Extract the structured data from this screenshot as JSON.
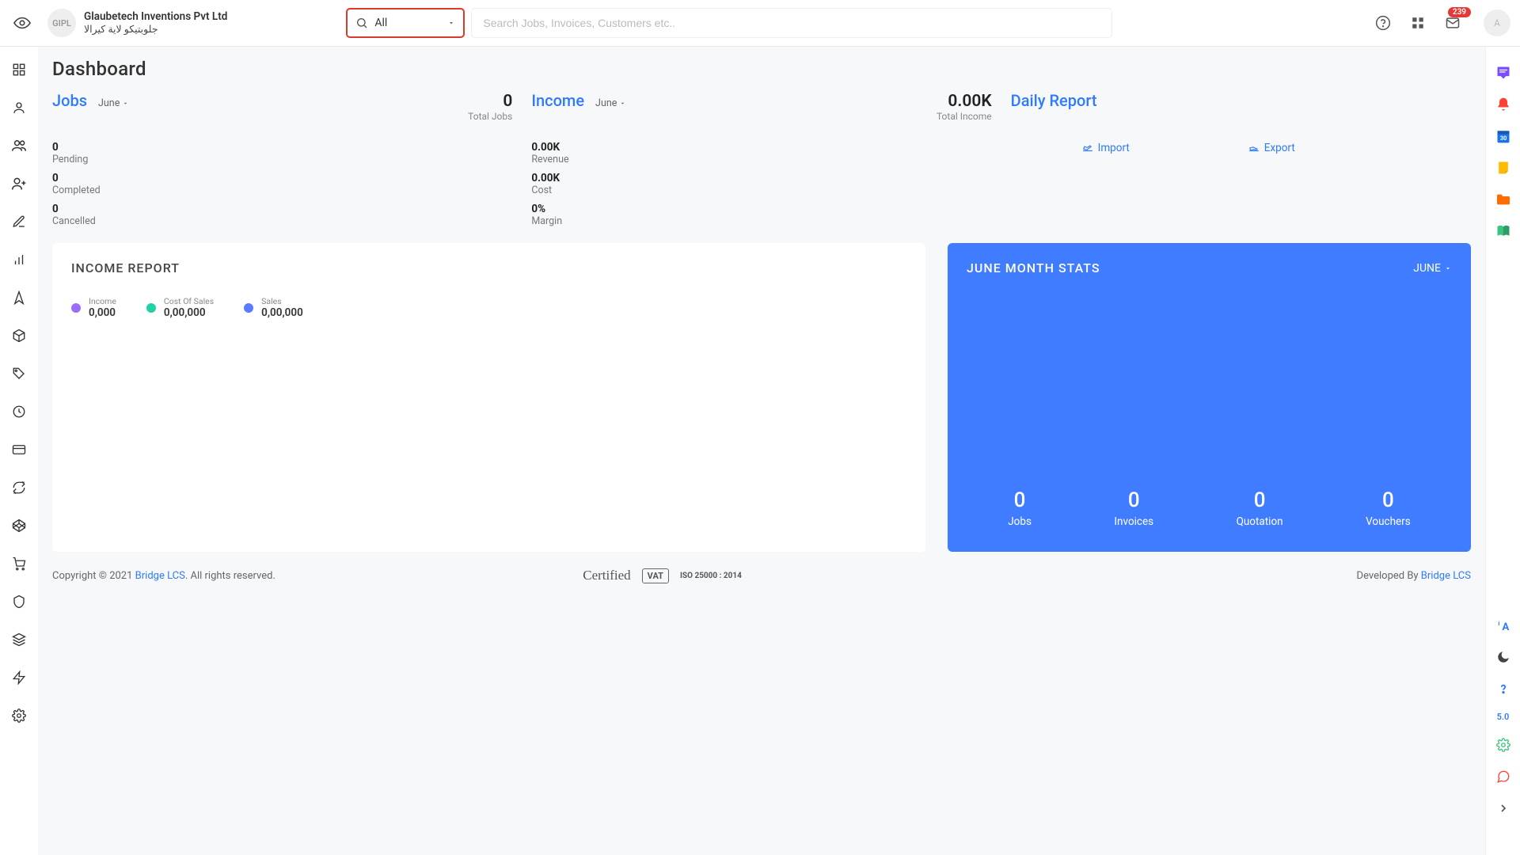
{
  "header": {
    "company_initials": "GIPL",
    "company_name": "Glaubetech Inventions Pvt Ltd",
    "company_sub": "جلوبتيكو لاية كيرالا",
    "search_scope": "All",
    "search_placeholder": "Search Jobs, Invoices, Customers etc..",
    "mail_badge": "239",
    "user_initial": "A"
  },
  "page_title": "Dashboard",
  "jobs": {
    "title": "Jobs",
    "month": "June",
    "total_val": "0",
    "total_lbl": "Total Jobs",
    "items": [
      {
        "v": "0",
        "l": "Pending"
      },
      {
        "v": "0",
        "l": "Completed"
      },
      {
        "v": "0",
        "l": "Cancelled"
      }
    ]
  },
  "income": {
    "title": "Income",
    "month": "June",
    "total_val": "0.00K",
    "total_lbl": "Total Income",
    "items": [
      {
        "v": "0.00K",
        "l": "Revenue"
      },
      {
        "v": "0.00K",
        "l": "Cost"
      },
      {
        "v": "0%",
        "l": "Margin"
      }
    ]
  },
  "daily_report": {
    "title": "Daily Report",
    "import": "Import",
    "export": "Export"
  },
  "income_report": {
    "title": "INCOME REPORT",
    "legend": [
      {
        "t": "Income",
        "v": "0,000",
        "color": "purple"
      },
      {
        "t": "Cost Of Sales",
        "v": "0,00,000",
        "color": "green"
      },
      {
        "t": "Sales",
        "v": "0,00,000",
        "color": "blue"
      }
    ]
  },
  "month_stats": {
    "title": "JUNE MONTH STATS",
    "dd": "JUNE",
    "items": [
      {
        "v": "0",
        "l": "Jobs"
      },
      {
        "v": "0",
        "l": "Invoices"
      },
      {
        "v": "0",
        "l": "Quotation"
      },
      {
        "v": "0",
        "l": "Vouchers"
      }
    ]
  },
  "footer": {
    "copyright_pre": "Copyright © 2021 ",
    "brand": "Bridge LCS",
    "copyright_post": ". All rights reserved.",
    "certified": "Certified",
    "vat": "VAT",
    "iso": "ISO 25000 : 2014",
    "dev_pre": "Developed By ",
    "dev_brand": "Bridge LCS"
  },
  "right_rail": {
    "calendar_day": "30",
    "version": "5.0"
  }
}
